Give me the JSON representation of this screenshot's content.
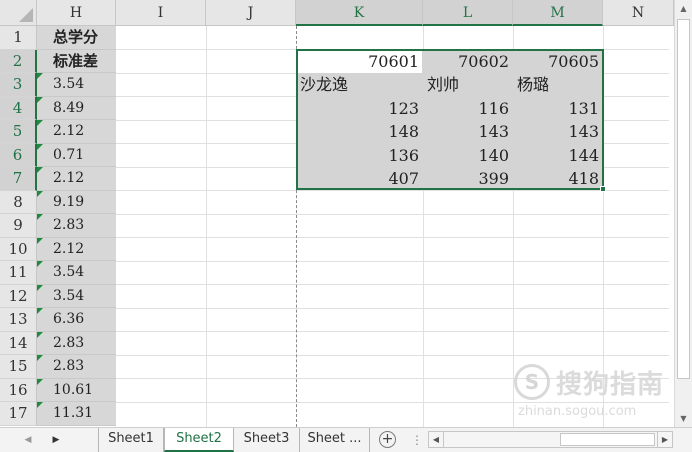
{
  "columns": [
    "H",
    "I",
    "J",
    "K",
    "L",
    "M",
    "N"
  ],
  "rows": [
    "1",
    "2",
    "3",
    "4",
    "5",
    "6",
    "7",
    "8",
    "9",
    "10",
    "11",
    "12",
    "13",
    "14",
    "15",
    "16",
    "17"
  ],
  "col_h": {
    "header1": "总学分",
    "header2": "标准差",
    "values": [
      "3.54",
      "8.49",
      "2.12",
      "0.71",
      "2.12",
      "9.19",
      "2.83",
      "2.12",
      "3.54",
      "3.54",
      "6.36",
      "2.83",
      "2.83",
      "10.61",
      "11.31"
    ]
  },
  "table": {
    "ids": [
      "70601",
      "70602",
      "70605"
    ],
    "names": [
      "沙龙逸",
      "刘帅",
      "杨璐"
    ],
    "rows": [
      [
        "123",
        "116",
        "131"
      ],
      [
        "148",
        "143",
        "143"
      ],
      [
        "136",
        "140",
        "144"
      ],
      [
        "407",
        "399",
        "418"
      ]
    ]
  },
  "sheet_tabs": [
    "Sheet1",
    "Sheet2",
    "Sheet3",
    "Sheet ..."
  ],
  "active_tab": "Sheet2",
  "add_sheet_label": "+",
  "watermark": {
    "glyph": "S",
    "text": "搜狗指南",
    "url": "zhinan.sogou.com"
  },
  "colors": {
    "accent": "#217346",
    "selection_fill": "#d4d4d4",
    "header_fill": "#e6e6e6",
    "comment_marker": "#1e8a3e"
  }
}
